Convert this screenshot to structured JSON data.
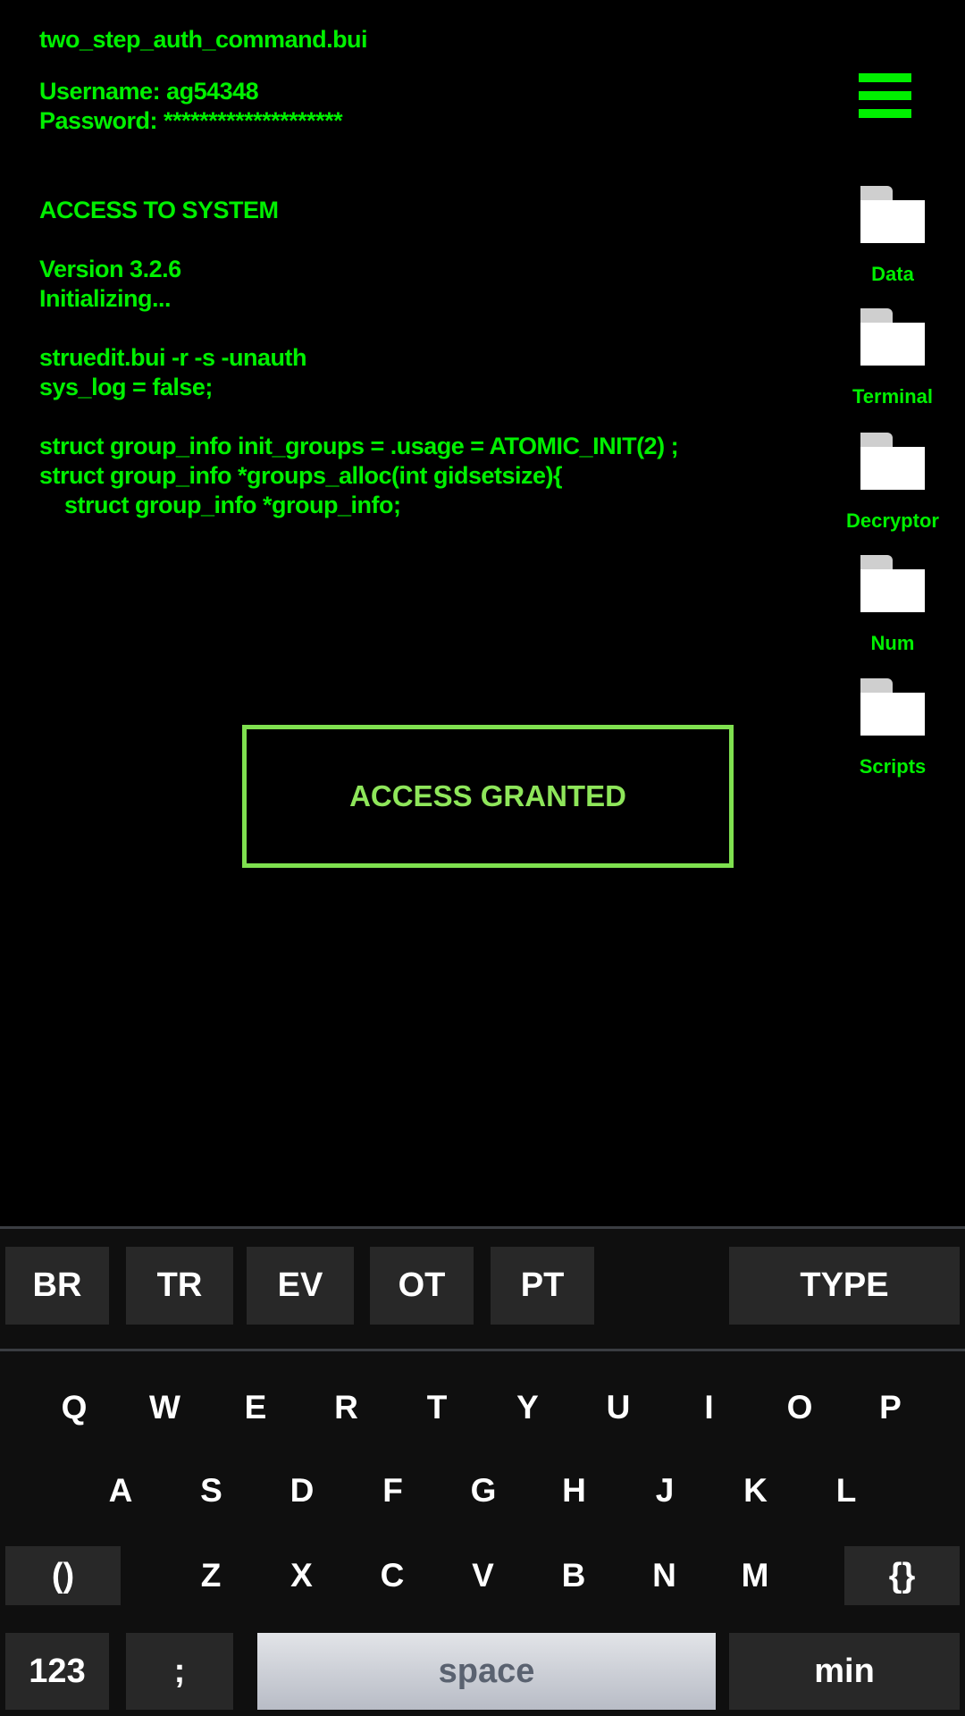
{
  "terminal": {
    "lines": [
      "two_step_auth_command.bui",
      "Username: ag54348",
      "Password: ********************",
      "ACCESS TO SYSTEM",
      "Version 3.2.6",
      "Initializing...",
      "struedit.bui -r -s -unauth",
      "sys_log = false;",
      "struct group_info init_groups = .usage = ATOMIC_INIT(2) ;",
      "struct group_info *groups_alloc(int gidsetsize){",
      "    struct group_info *group_info;"
    ]
  },
  "menu_icon": "hamburger-menu-icon",
  "folders": [
    {
      "label": "Data",
      "icon": "folder-icon"
    },
    {
      "label": "Terminal",
      "icon": "folder-icon"
    },
    {
      "label": "Decryptor",
      "icon": "folder-icon"
    },
    {
      "label": "Num",
      "icon": "folder-icon"
    },
    {
      "label": "Scripts",
      "icon": "folder-icon"
    }
  ],
  "status": {
    "label": "ACCESS GRANTED",
    "color": "#7fe04f"
  },
  "keyboard": {
    "suggestions": [
      "BR",
      "TR",
      "EV",
      "OT",
      "PT"
    ],
    "type_label": "TYPE",
    "row1": [
      "Q",
      "W",
      "E",
      "R",
      "T",
      "Y",
      "U",
      "I",
      "O",
      "P"
    ],
    "row2": [
      "A",
      "S",
      "D",
      "F",
      "G",
      "H",
      "J",
      "K",
      "L"
    ],
    "row3": [
      "Z",
      "X",
      "C",
      "V",
      "B",
      "N",
      "M"
    ],
    "parens": "()",
    "braces": "{}",
    "num": "123",
    "semicolon": ";",
    "space": "space",
    "min": "min"
  },
  "colors": {
    "terminal_text": "#00f000",
    "background": "#000000",
    "keyboard_bg": "#0f0f0f"
  }
}
